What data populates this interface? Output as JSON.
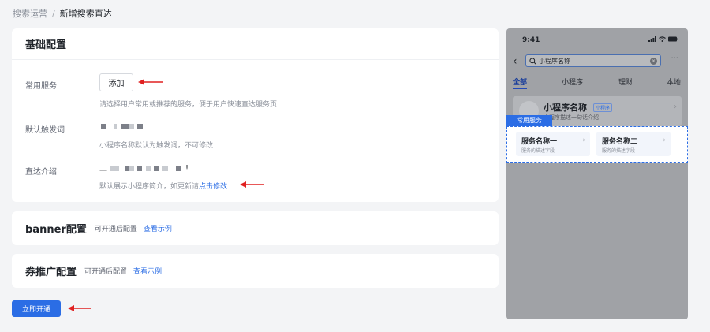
{
  "breadcrumb": {
    "parent": "搜索运营",
    "separator": "/",
    "current": "新增搜索直达"
  },
  "basic_config": {
    "title": "基础配置",
    "common_service": {
      "label": "常用服务",
      "add_button": "添加",
      "desc": "请选择用户常用或推荐的服务，便于用户快速直达服务页"
    },
    "default_keyword": {
      "label": "默认触发词",
      "desc": "小程序名称默认为触发词，不可修改"
    },
    "intro": {
      "label": "直达介绍",
      "value_prefix": "一",
      "value_suffix": "!",
      "desc_prefix": "默认展示小程序简介，如更新请",
      "desc_link": "点击修改"
    }
  },
  "banner_config": {
    "title": "banner配置",
    "note": "可开通后配置",
    "link": "查看示例"
  },
  "coupon_config": {
    "title": "券推广配置",
    "note": "可开通后配置",
    "link": "查看示例"
  },
  "open_button": "立即开通",
  "phone_preview": {
    "time": "9:41",
    "search_text": "小程序名称",
    "clear_glyph": "×",
    "more_glyph": "···",
    "back_glyph": "‹",
    "tabs": [
      "全部",
      "小程序",
      "理财",
      "本地"
    ],
    "miniapp_name": "小程序名称",
    "miniapp_tag": "小程序",
    "miniapp_desc": "小程序描述一句话介绍",
    "service_badge": "常用服务",
    "services": [
      {
        "name": "服务名称一",
        "desc": "服务的描述字段"
      },
      {
        "name": "服务名称二",
        "desc": "服务的描述字段"
      }
    ]
  },
  "colors": {
    "primary": "#2b6de5",
    "annotation_arrow": "#e02020"
  }
}
